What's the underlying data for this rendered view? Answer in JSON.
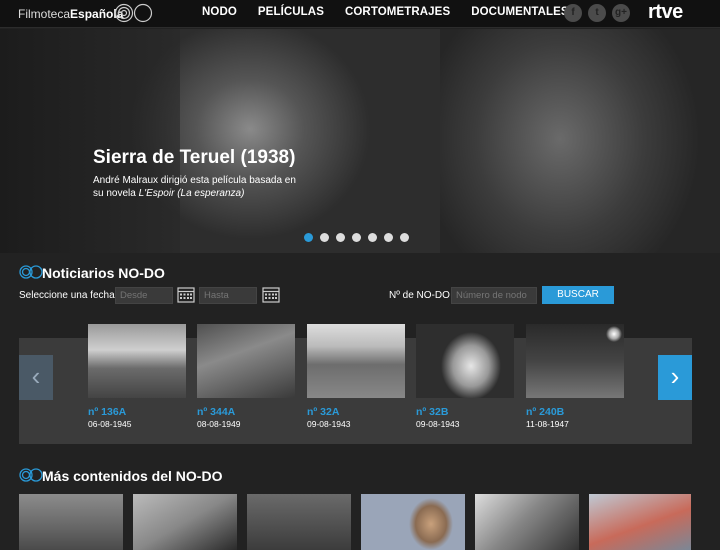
{
  "header": {
    "logo_light": "Filmoteca",
    "logo_bold": "Española",
    "nav": [
      "NODO",
      "PELÍCULAS",
      "CORTOMETRAJES",
      "DOCUMENTALES"
    ],
    "social": [
      {
        "name": "facebook-icon",
        "glyph": "f"
      },
      {
        "name": "twitter-icon",
        "glyph": "t"
      },
      {
        "name": "google-plus-icon",
        "glyph": "g+"
      }
    ],
    "brand": "rtve"
  },
  "hero": {
    "title": "Sierra de Teruel (1938)",
    "desc_1": "André Malraux dirigió esta película basada en su novela ",
    "desc_italic": "L'Espoir (La esperanza)",
    "slides": 7,
    "active_slide": 1
  },
  "noticiarios": {
    "title": "Noticiarios NO-DO",
    "date_label": "Seleccione una fecha",
    "from_placeholder": "Desde",
    "to_placeholder": "Hasta",
    "num_label": "Nº de NO-DO",
    "num_placeholder": "Número de nodo",
    "search_button": "BUSCAR",
    "items": [
      {
        "num": "nº 136A",
        "date": "06-08-1945"
      },
      {
        "num": "nº 344A",
        "date": "08-08-1949"
      },
      {
        "num": "nº 32A",
        "date": "09-08-1943"
      },
      {
        "num": "nº 32B",
        "date": "09-08-1943"
      },
      {
        "num": "nº 240B",
        "date": "11-08-1947"
      }
    ]
  },
  "mas": {
    "title": "Más contenidos del NO-DO"
  },
  "colors": {
    "accent": "#2a9ad8",
    "background": "#222222",
    "carousel_bg": "#3b3b3b"
  }
}
